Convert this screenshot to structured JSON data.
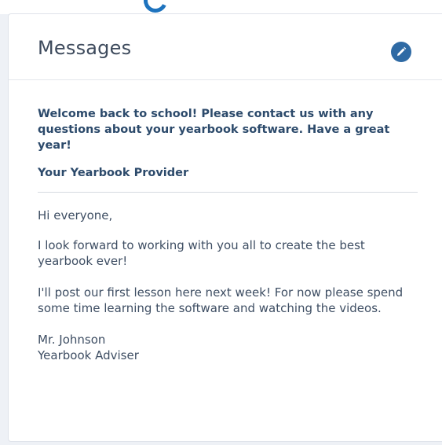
{
  "panel": {
    "title": "Messages",
    "edit_icon": "pencil-icon",
    "accent_color": "#2f6aa4"
  },
  "announcement": {
    "text": "Welcome back to school! Please contact us with any questions about your yearbook software. Have a great year!",
    "from": "Your Yearbook Provider"
  },
  "message": {
    "greeting": "Hi everyone,",
    "paragraph_1": "I look forward to working with you all to create the best yearbook ever!",
    "paragraph_2": "I'll post our first lesson here next week! For now please spend some time learning the software and watching the videos.",
    "sender_name": "Mr. Johnson",
    "sender_role": "Yearbook Adviser"
  }
}
